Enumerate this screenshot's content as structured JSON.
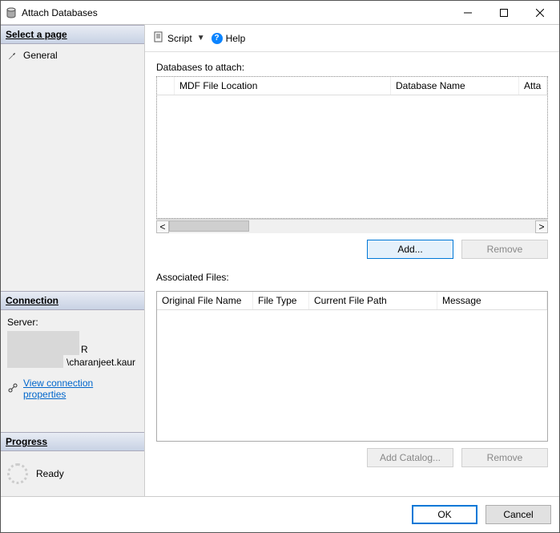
{
  "window": {
    "title": "Attach Databases"
  },
  "sidebar": {
    "select_page": {
      "header": "Select a page",
      "items": [
        "General"
      ]
    },
    "connection": {
      "header": "Connection",
      "server_label": "Server:",
      "server_name_suffix": "R",
      "user_suffix": "\\charanjeet.kaur",
      "view_props": "View connection properties"
    },
    "progress": {
      "header": "Progress",
      "status": "Ready"
    }
  },
  "toolbar": {
    "script": "Script",
    "help": "Help"
  },
  "main": {
    "databases_label": "Databases to attach:",
    "db_columns": {
      "mdf": "MDF File Location",
      "dbname": "Database Name",
      "attach": "Atta"
    },
    "add_btn": "Add...",
    "remove_btn": "Remove",
    "assoc_label": "Associated Files:",
    "assoc_columns": {
      "orig": "Original File Name",
      "ftype": "File Type",
      "path": "Current File Path",
      "msg": "Message"
    },
    "add_catalog_btn": "Add Catalog...",
    "remove2_btn": "Remove"
  },
  "footer": {
    "ok": "OK",
    "cancel": "Cancel"
  }
}
